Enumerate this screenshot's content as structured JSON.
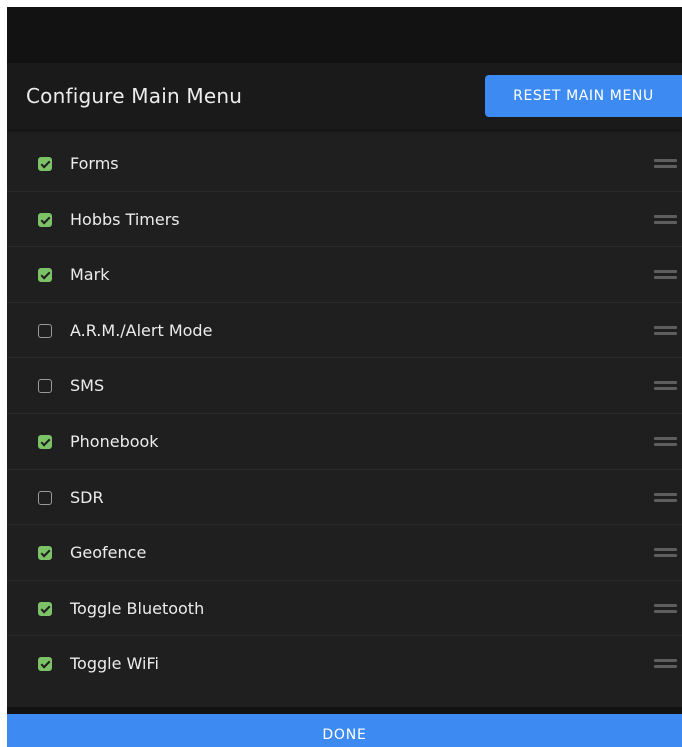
{
  "header": {
    "title": "Configure Main Menu",
    "reset_label": "RESET MAIN MENU"
  },
  "menu_items": [
    {
      "label": "Forms",
      "checked": true
    },
    {
      "label": "Hobbs Timers",
      "checked": true
    },
    {
      "label": "Mark",
      "checked": true
    },
    {
      "label": "A.R.M./Alert Mode",
      "checked": false
    },
    {
      "label": "SMS",
      "checked": false
    },
    {
      "label": "Phonebook",
      "checked": true
    },
    {
      "label": "SDR",
      "checked": false
    },
    {
      "label": "Geofence",
      "checked": true
    },
    {
      "label": "Toggle Bluetooth",
      "checked": true
    },
    {
      "label": "Toggle WiFi",
      "checked": true
    }
  ],
  "footer": {
    "done_label": "DONE"
  },
  "colors": {
    "accent": "#3d8bf2",
    "check_on": "#7cc267",
    "background": "#1f1f1f",
    "header_bg": "#1a1a1a"
  },
  "icons": {
    "checkbox": "checkbox-icon",
    "drag": "drag-handle-icon"
  }
}
